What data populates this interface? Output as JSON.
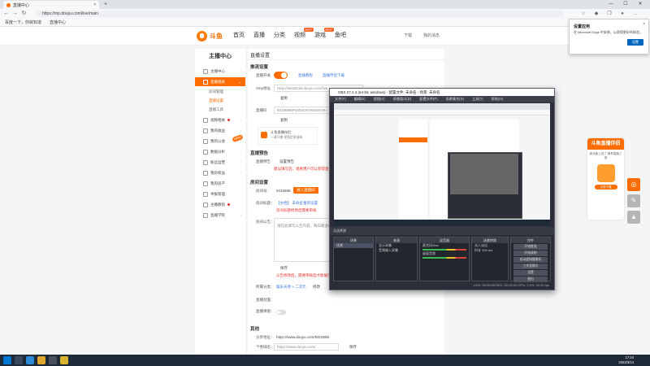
{
  "browser": {
    "tab_title": "直播中心",
    "tab_close": "×",
    "new_tab": "+",
    "url": "https://mp.douyu.com/live/main",
    "favorites": [
      "百度一下，你就知道",
      "直播中心"
    ],
    "window_controls": [
      "—",
      "☐",
      "✕"
    ]
  },
  "edge_popup": {
    "title": "设置应用",
    "desc": "在 Microsoft Edge 中安装，以获得更好的体验。",
    "button": "设置",
    "close": "×"
  },
  "site": {
    "brand": "斗鱼",
    "nav": [
      "首页",
      "直播",
      "分类",
      "视频",
      "游戏",
      "鱼吧"
    ],
    "hot_label": "HOT",
    "header_right": [
      "下载",
      "我的消息"
    ]
  },
  "sidebar": {
    "title": "主播中心",
    "items": [
      {
        "label": "主播中心",
        "active": false
      },
      {
        "label": "直播相关",
        "active": true
      },
      {
        "label": "视频相关",
        "active": false
      },
      {
        "label": "我的收益",
        "active": false
      },
      {
        "label": "我的公会",
        "active": false
      },
      {
        "label": "数据分析",
        "active": false
      },
      {
        "label": "粉丝运营",
        "active": false
      },
      {
        "label": "我的权益",
        "active": false
      },
      {
        "label": "我的房产",
        "active": false
      },
      {
        "label": "举报管理",
        "active": false
      },
      {
        "label": "主播教程",
        "active": false
      },
      {
        "label": "直播学院",
        "active": false
      }
    ],
    "subitems": [
      "房间管理",
      "直播设置",
      "直播工具"
    ],
    "new_badge": "NEW"
  },
  "main": {
    "page_title": "直播设置",
    "push_section": "推流设置",
    "live_switch_label": "直播开关",
    "live_link_1": "直播教程",
    "live_link_2": "直播伴侣下载",
    "rtmp_label": "rtmp地址",
    "rtmp_value": "rtmp://sendtc3a.douyu.com/live",
    "copy": "复制",
    "code_label": "直播码",
    "code_value": "9315688rPxaZuCN?wsSecret=",
    "tool_title": "斗鱼直播伴侣",
    "tool_sub": "一键开播·更稳定更清晰",
    "preview_section": "直播预告",
    "preview_label": "直播预告",
    "preview_value": "设置预告",
    "preview_hint": "建议填写后，观看用户可以获得直播通知",
    "room_section": "房间设置",
    "room_id_label": "房间号：",
    "room_id_value": "9315688",
    "room_btn_1": "进入直播间",
    "room_title_label": "房间标题：",
    "room_title_value": "【文档】 未命名",
    "room_title_edit": "重新设置",
    "room_title_hint": "房间标题修改后需要审核",
    "room_notice_label": "房间公告：",
    "room_notice_placeholder": "请在此填写公告内容，每日最多修改三次",
    "save_label": "保存",
    "notice_hint": "公告修改后，需要审核后才能展示",
    "category_label": "所属分类：",
    "category_value": "娱乐天地 > 二次元",
    "category_edit": "修改",
    "cover_label": "直播封面：",
    "cover_toggle_label": "直播弹窗：",
    "other_section": "其他",
    "share_label": "分享地址：",
    "share_value": "https://www.douyu.com/9315688",
    "domain_label": "个性域名：",
    "domain_value": "https://www.douyu.com/",
    "domain_btn": "保存"
  },
  "promo": {
    "title": "斗鱼直播伴侣",
    "subtitle": "新功能上线了 畅享直播工具",
    "button": "立即下载"
  },
  "obs": {
    "title": "OBS 27.2.4 (64-bit, windows) - 配置文件: 未命名 - 场景: 未命名",
    "menu": [
      "文件(F)",
      "编辑(E)",
      "视图(V)",
      "停靠窗口(D)",
      "配置文件(P)",
      "场景集合(S)",
      "工具(T)",
      "帮助(H)"
    ],
    "toolbar_text": "无选择源",
    "docks": [
      {
        "title": "场景",
        "rows": [
          "场景"
        ]
      },
      {
        "title": "来源",
        "rows": [
          "显示采集",
          "音频输入采集"
        ]
      },
      {
        "title": "混音器",
        "rows": [
          "麦克风/Aux",
          "桌面音频"
        ]
      },
      {
        "title": "场景转换",
        "rows": [
          "淡入淡出",
          "时长 300 ms"
        ]
      },
      {
        "title": "控件",
        "rows": []
      }
    ],
    "controls": [
      "开始推流",
      "开始录制",
      "启动虚拟摄像机",
      "工作室模式",
      "设置",
      "退出"
    ],
    "status": "LIVE: 00:00:00   REC: 00:00:00   CPU: 1.5%, 30.00 fps"
  },
  "taskbar": {
    "time": "17:44",
    "date": "2022/3/14"
  },
  "colors": {
    "accent": "#ff6d00",
    "link": "#3b7ae8",
    "alert": "#e8312a",
    "obs_bg": "#2b2e38"
  }
}
